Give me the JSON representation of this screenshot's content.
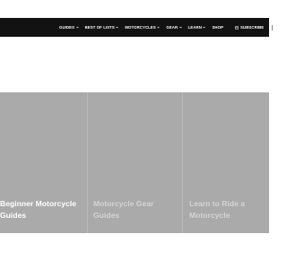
{
  "nav": {
    "items": [
      {
        "label": "GUIDES",
        "dropdown": true
      },
      {
        "label": "BEST OF LISTS",
        "dropdown": true
      },
      {
        "label": "MOTORCYCLES",
        "dropdown": true
      },
      {
        "label": "GEAR",
        "dropdown": true
      },
      {
        "label": "LEARN",
        "dropdown": true
      },
      {
        "label": "SHOP",
        "dropdown": false
      }
    ],
    "subscribe_label": "SUBSCRIBE",
    "subscribe_icon": "envelope-icon",
    "overflow_label": "S"
  },
  "cards": [
    {
      "title": "Beginner Motorcycle Guides"
    },
    {
      "title": "Motorcycle Gear Guides"
    },
    {
      "title": "Learn to Ride a Motorcycle"
    }
  ],
  "colors": {
    "navbar_bg": "#121212",
    "card_bg": "#aaaaaa",
    "active_title": "#ffffff",
    "faded_title": "#d4d4d4"
  }
}
